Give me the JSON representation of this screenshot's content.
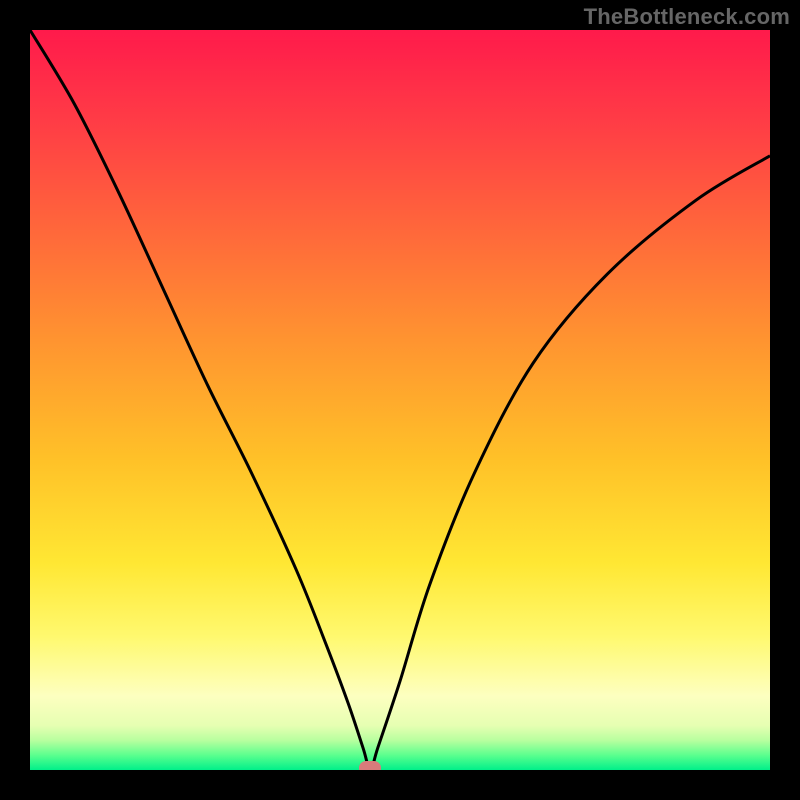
{
  "watermark": "TheBottleneck.com",
  "chart_data": {
    "type": "line",
    "title": "",
    "xlabel": "",
    "ylabel": "",
    "xlim": [
      0,
      100
    ],
    "ylim": [
      0,
      100
    ],
    "grid": false,
    "legend": false,
    "series": [
      {
        "name": "curve",
        "x": [
          0,
          6,
          12,
          18,
          24,
          30,
          36,
          40,
          43,
          45,
          46,
          47,
          50,
          54,
          60,
          68,
          78,
          90,
          100
        ],
        "values": [
          100,
          90,
          78,
          65,
          52,
          40,
          27,
          17,
          9,
          3,
          0,
          3,
          12,
          25,
          40,
          55,
          67,
          77,
          83
        ]
      }
    ],
    "marker": {
      "x": 46,
      "y": 0
    }
  },
  "colors": {
    "curve_stroke": "#000000",
    "marker_fill": "#d97b7b",
    "frame": "#000000"
  }
}
